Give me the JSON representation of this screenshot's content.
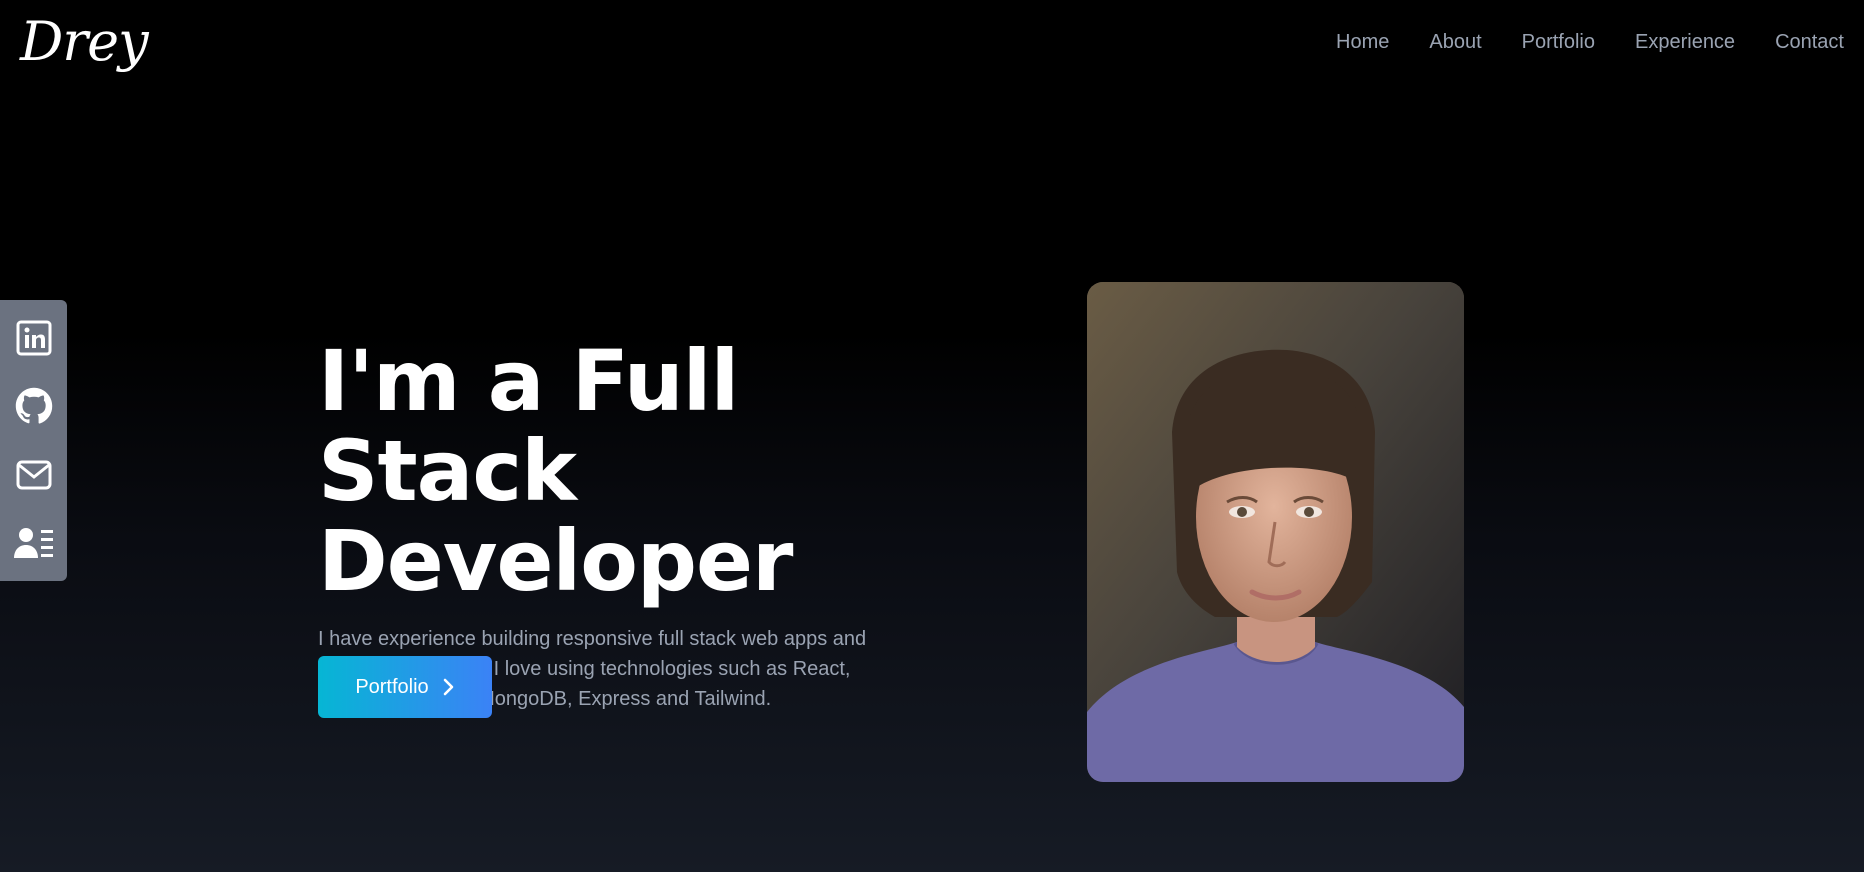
{
  "brand": {
    "logo_text": "Drey"
  },
  "nav": {
    "links": [
      {
        "label": "Home"
      },
      {
        "label": "About"
      },
      {
        "label": "Portfolio"
      },
      {
        "label": "Experience"
      },
      {
        "label": "Contact"
      }
    ]
  },
  "social": {
    "items": [
      {
        "icon": "linkedin-icon"
      },
      {
        "icon": "github-icon"
      },
      {
        "icon": "mail-icon"
      },
      {
        "icon": "resume-icon"
      }
    ],
    "bar_color": "#6b7280"
  },
  "hero": {
    "headline_line1": "I'm a Full Stack",
    "headline_line2": "Developer",
    "bio": "I have experience building responsive full stack web apps and websites. Currently I love using technologies such as React, Node, Javascript, MongoDB, Express and Tailwind.",
    "cta_label": "Portfolio",
    "cta_icon": "chevron-right-icon",
    "cta_gradient": [
      "#06b6d4",
      "#3b82f6"
    ]
  },
  "colors": {
    "text_muted": "#9aa3b2",
    "background_top": "#000000",
    "background_bottom": "#161b25"
  }
}
